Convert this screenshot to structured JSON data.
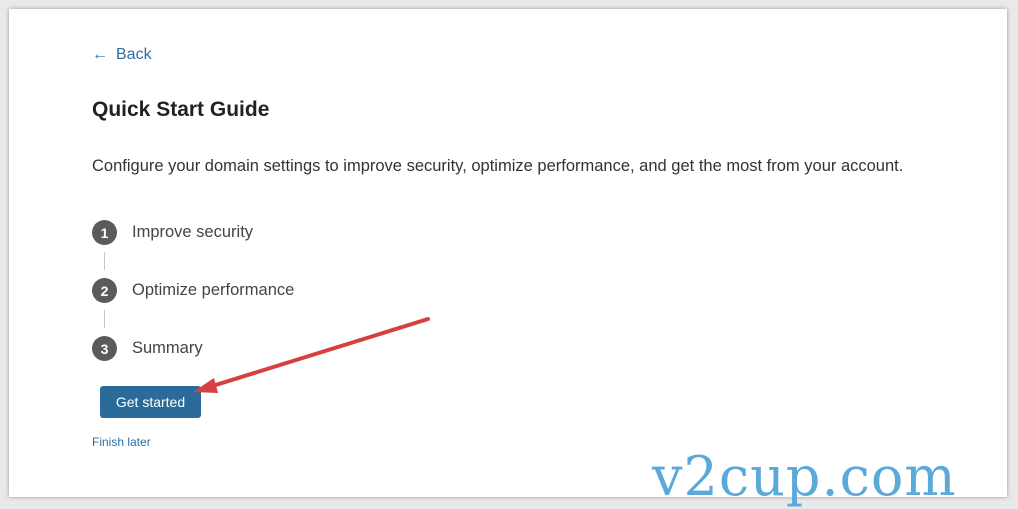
{
  "nav": {
    "back_label": "Back",
    "back_icon": "arrow-left-icon"
  },
  "page": {
    "title": "Quick Start Guide",
    "description": "Configure your domain settings to improve security, optimize performance, and get the most from your account."
  },
  "steps": [
    {
      "number": "1",
      "label": "Improve security"
    },
    {
      "number": "2",
      "label": "Optimize performance"
    },
    {
      "number": "3",
      "label": "Summary"
    }
  ],
  "actions": {
    "primary_label": "Get started",
    "secondary_label": "Finish later"
  },
  "watermark": "v2cup.com",
  "colors": {
    "accent": "#2b6b9b",
    "link": "#2f6fa3",
    "step_circle": "#5b5b5b",
    "annotation_arrow": "#d64040",
    "watermark": "#5aa9d8"
  }
}
